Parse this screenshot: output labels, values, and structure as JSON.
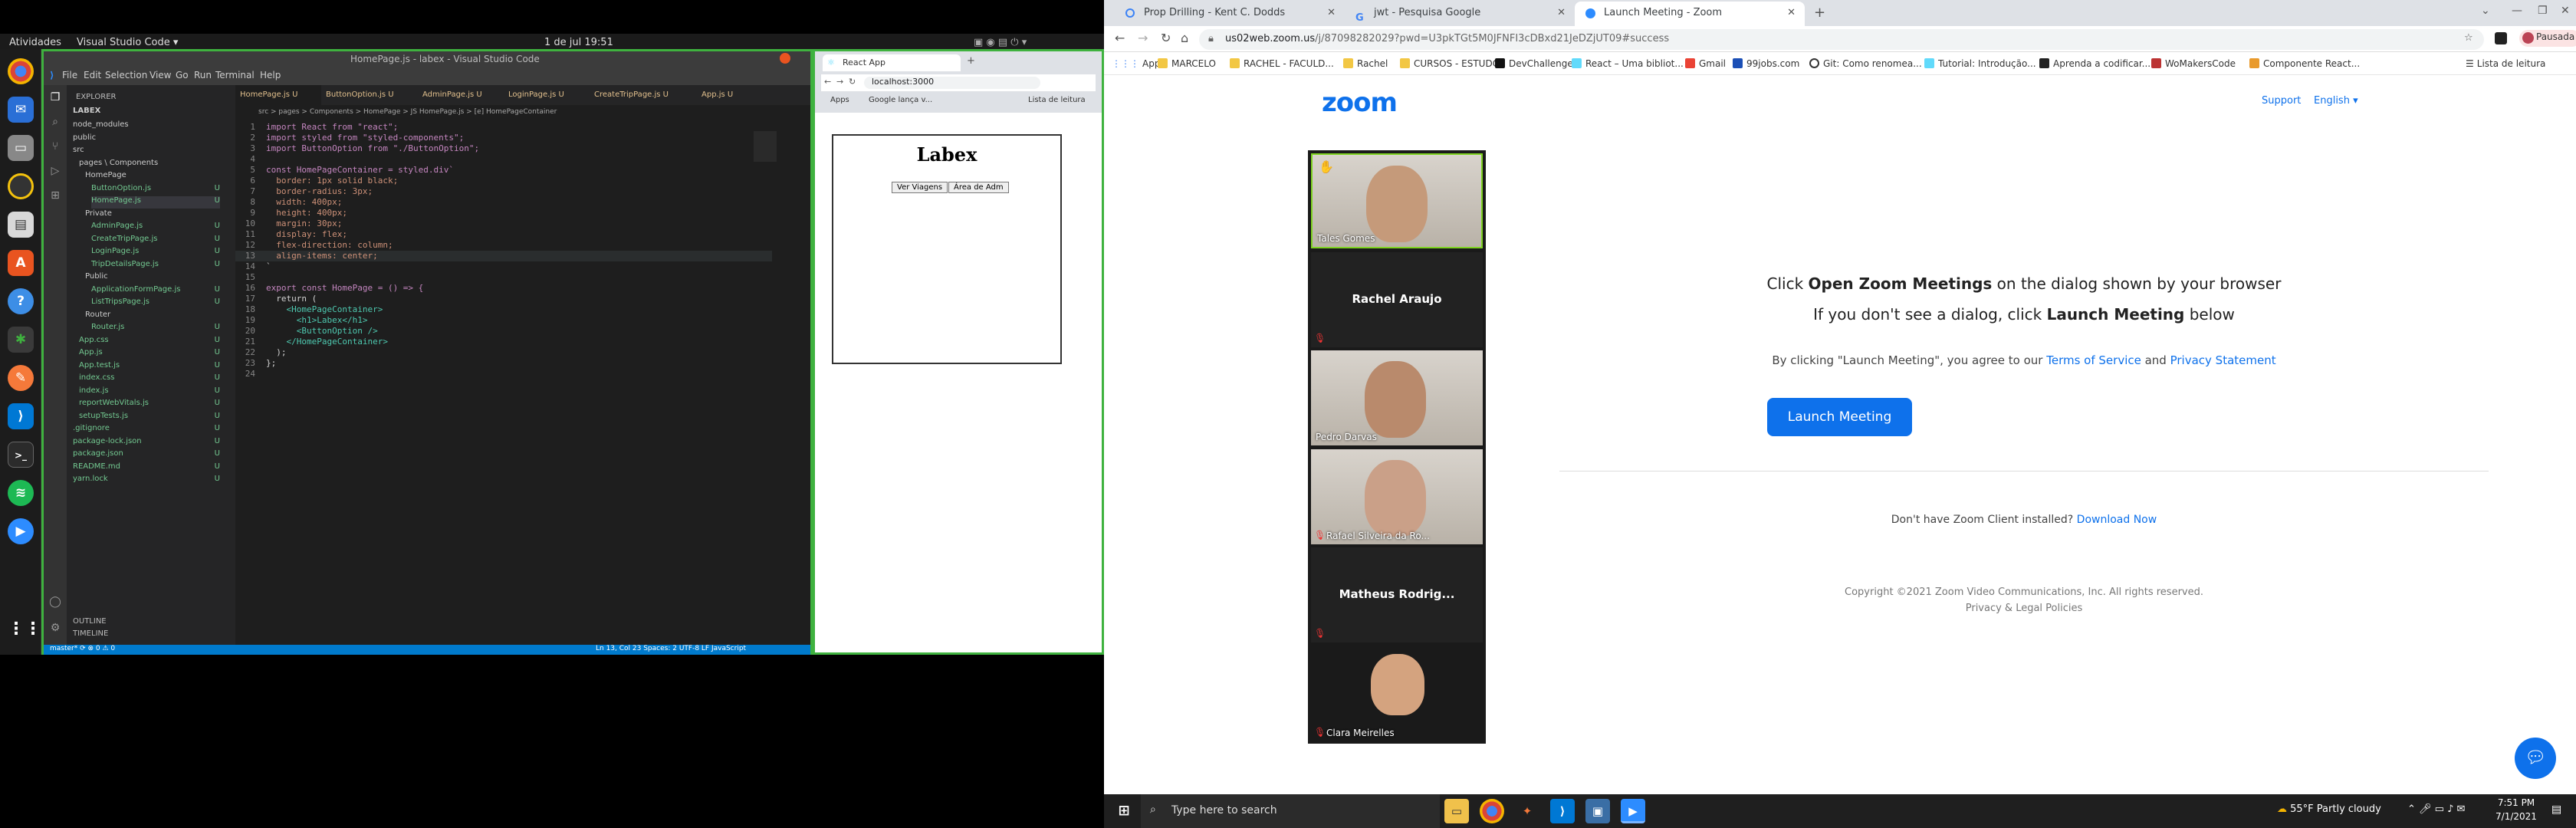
{
  "left": {
    "gnome": {
      "activities": "Atividades",
      "app": "Visual Studio Code ▾",
      "clock": "1 de jul  19:51"
    },
    "vscode": {
      "title": "HomePage.js - labex - Visual Studio Code",
      "menu": [
        "File",
        "Edit",
        "Selection",
        "View",
        "Go",
        "Run",
        "Terminal",
        "Help"
      ],
      "explorer_title": "EXPLORER",
      "root": "LABEX",
      "tree": [
        {
          "label": "node_modules",
          "badge": "",
          "indent": 1
        },
        {
          "label": "public",
          "badge": "",
          "indent": 1
        },
        {
          "label": "src",
          "badge": "",
          "indent": 1
        },
        {
          "label": "pages \\ Components",
          "badge": "",
          "indent": 2
        },
        {
          "label": "HomePage",
          "badge": "",
          "indent": 3
        },
        {
          "label": "ButtonOption.js",
          "badge": "U",
          "indent": 4
        },
        {
          "label": "HomePage.js",
          "badge": "U",
          "indent": 4
        },
        {
          "label": "Private",
          "badge": "",
          "indent": 3
        },
        {
          "label": "AdminPage.js",
          "badge": "U",
          "indent": 4
        },
        {
          "label": "CreateTripPage.js",
          "badge": "U",
          "indent": 4
        },
        {
          "label": "LoginPage.js",
          "badge": "U",
          "indent": 4
        },
        {
          "label": "TripDetailsPage.js",
          "badge": "U",
          "indent": 4
        },
        {
          "label": "Public",
          "badge": "",
          "indent": 3
        },
        {
          "label": "ApplicationFormPage.js",
          "badge": "U",
          "indent": 4
        },
        {
          "label": "ListTripsPage.js",
          "badge": "U",
          "indent": 4
        },
        {
          "label": "Router",
          "badge": "",
          "indent": 3
        },
        {
          "label": "Router.js",
          "badge": "U",
          "indent": 4
        },
        {
          "label": "App.css",
          "badge": "U",
          "indent": 2
        },
        {
          "label": "App.js",
          "badge": "U",
          "indent": 2
        },
        {
          "label": "App.test.js",
          "badge": "U",
          "indent": 2
        },
        {
          "label": "index.css",
          "badge": "U",
          "indent": 2
        },
        {
          "label": "index.js",
          "badge": "U",
          "indent": 2
        },
        {
          "label": "reportWebVitals.js",
          "badge": "U",
          "indent": 2
        },
        {
          "label": "setupTests.js",
          "badge": "U",
          "indent": 2
        },
        {
          "label": ".gitignore",
          "badge": "U",
          "indent": 1
        },
        {
          "label": "package-lock.json",
          "badge": "U",
          "indent": 1
        },
        {
          "label": "package.json",
          "badge": "U",
          "indent": 1
        },
        {
          "label": "README.md",
          "badge": "U",
          "indent": 1
        },
        {
          "label": "yarn.lock",
          "badge": "U",
          "indent": 1
        }
      ],
      "outline": "OUTLINE",
      "timeline": "TIMELINE",
      "tabs": [
        "HomePage.js U",
        "ButtonOption.js U",
        "AdminPage.js U",
        "LoginPage.js U",
        "CreateTripPage.js U",
        "App.js U"
      ],
      "breadcrumb": "src > pages > Components > HomePage > JS HomePage.js > [e] HomePageContainer",
      "code": [
        "import React from \"react\";",
        "import styled from \"styled-components\";",
        "import ButtonOption from \"./ButtonOption\";",
        "",
        "const HomePageContainer = styled.div`",
        "  border: 1px solid black;",
        "  border-radius: 3px;",
        "  width: 400px;",
        "  height: 400px;",
        "  margin: 30px;",
        "  display: flex;",
        "  flex-direction: column;",
        "  align-items: center;",
        "`",
        "",
        "export const HomePage = () => {",
        "  return (",
        "    <HomePageContainer>",
        "      <h1>Labex</h1>",
        "      <ButtonOption />",
        "    </HomePageContainer>",
        "  );",
        "};",
        ""
      ],
      "status_left": "master*  ⟳  ⊗ 0 ⚠ 0",
      "status_right": "Ln 13, Col 23   Spaces: 2   UTF-8   LF   JavaScript"
    },
    "browser": {
      "tab_title": "React App",
      "url": "localhost:3000",
      "bookmarks": [
        "Apps",
        "Google lança v...",
        "Lista de leitura"
      ],
      "heading": "Labex",
      "buttons": [
        "Ver Viagens",
        "Área de Adm"
      ]
    }
  },
  "right": {
    "tabs": [
      {
        "title": "Prop Drilling - Kent C. Dodds",
        "color": "#3b82f6"
      },
      {
        "title": "jwt - Pesquisa Google",
        "color": "#4285f4"
      },
      {
        "title": "Launch Meeting - Zoom",
        "color": "#2d8cff"
      }
    ],
    "url_host": "us02web.zoom.us",
    "url_path": "/j/87098282029?pwd=U3pkTGt5M0JFNFI3cDBxd21JeDZjUT09#success",
    "profile": "Pausada",
    "bookmarks": [
      "Apps",
      "MARCELO",
      "RACHEL - FACULD...",
      "Rachel",
      "CURSOS - ESTUDO",
      "DevChallenge",
      "React – Uma bibliot...",
      "Gmail",
      "99jobs.com",
      "Git: Como renomea...",
      "Tutorial: Introdução...",
      "Aprenda a codificar...",
      "WoMakersCode",
      "Componente React..."
    ],
    "reading_list": "Lista de leitura",
    "zoom": {
      "logo": "zoom",
      "support": "Support",
      "language": "English ▾",
      "line1_pre": "Click ",
      "line1_bold": "Open Zoom Meetings",
      "line1_post": " on the dialog shown by your browser",
      "line2_pre": "If you don't see a dialog, click ",
      "line2_bold": "Launch Meeting",
      "line2_post": " below",
      "agree_pre": "By clicking \"Launch Meeting\", you agree to our ",
      "terms": "Terms of Service",
      "and": " and ",
      "privacy": "Privacy Statement",
      "launch": "Launch Meeting",
      "noclient": "Don't have Zoom Client installed? ",
      "download": "Download Now",
      "copyright": "Copyright ©2021 Zoom Video Communications, Inc. All rights reserved.",
      "policies": "Privacy & Legal Policies"
    },
    "participants": [
      {
        "name": "Tales Gomes",
        "video": true,
        "muted": false
      },
      {
        "name": "Rachel Araujo",
        "video": false,
        "muted": true
      },
      {
        "name": "Pedro Darvas",
        "video": true,
        "muted": false
      },
      {
        "name": "Rafael Silveira da Ro...",
        "video": true,
        "muted": true
      },
      {
        "name": "Matheus  Rodrig...",
        "video": false,
        "muted": true
      },
      {
        "name": "Clara Meirelles",
        "video": true,
        "muted": true
      }
    ],
    "taskbar": {
      "search": "Type here to search",
      "weather": "55°F  Partly cloudy",
      "time": "7:51 PM",
      "date": "7/1/2021"
    }
  },
  "colors": {
    "zoom_blue": "#0e71eb",
    "vscode_status": "#007acc",
    "active_frame": "#3fb23f"
  }
}
